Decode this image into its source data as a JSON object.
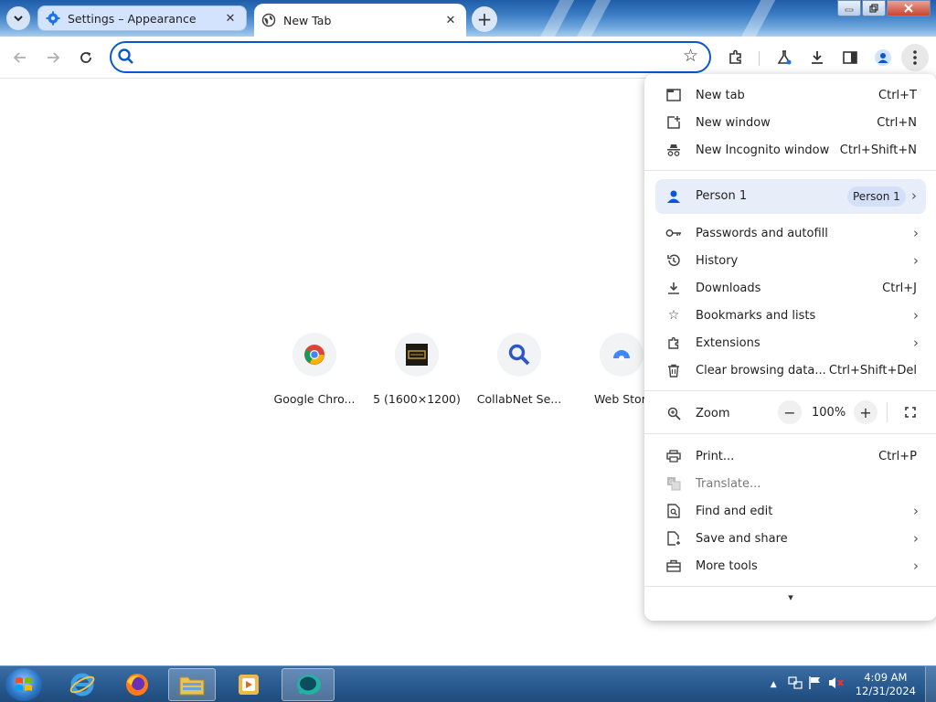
{
  "tabs": {
    "inactive_title": "Settings – Appearance",
    "active_title": "New Tab",
    "close_glyph": "✕",
    "new_tab_glyph": "+"
  },
  "toolbar": {
    "omnibox_value": "",
    "omnibox_placeholder": ""
  },
  "shortcuts": [
    {
      "label": "Google Chro...",
      "icon": "chrome-icon"
    },
    {
      "label": "5 (1600×1200)",
      "icon": "thumbnail-icon"
    },
    {
      "label": "CollabNet Se...",
      "icon": "search-icon"
    },
    {
      "label": "Web Store",
      "icon": "web-store-icon"
    }
  ],
  "menu": {
    "new_tab": {
      "label": "New tab",
      "shortcut": "Ctrl+T"
    },
    "new_window": {
      "label": "New window",
      "shortcut": "Ctrl+N"
    },
    "new_incognito": {
      "label": "New Incognito window",
      "shortcut": "Ctrl+Shift+N"
    },
    "profile": {
      "label": "Person 1",
      "badge": "Person 1"
    },
    "passwords": {
      "label": "Passwords and autofill"
    },
    "history": {
      "label": "History"
    },
    "downloads": {
      "label": "Downloads",
      "shortcut": "Ctrl+J"
    },
    "bookmarks": {
      "label": "Bookmarks and lists"
    },
    "extensions": {
      "label": "Extensions"
    },
    "clear_data": {
      "label": "Clear browsing data...",
      "shortcut": "Ctrl+Shift+Del"
    },
    "zoom": {
      "label": "Zoom",
      "value": "100%",
      "minus": "−",
      "plus": "+"
    },
    "print": {
      "label": "Print...",
      "shortcut": "Ctrl+P"
    },
    "translate": {
      "label": "Translate..."
    },
    "find_edit": {
      "label": "Find and edit"
    },
    "save_share": {
      "label": "Save and share"
    },
    "more_tools": {
      "label": "More tools"
    },
    "expand_glyph": "▾"
  },
  "taskbar": {
    "time": "4:09 AM",
    "date": "12/31/2024"
  },
  "colors": {
    "accent": "#0b57d0",
    "menu_highlight": "#e8eef9"
  }
}
